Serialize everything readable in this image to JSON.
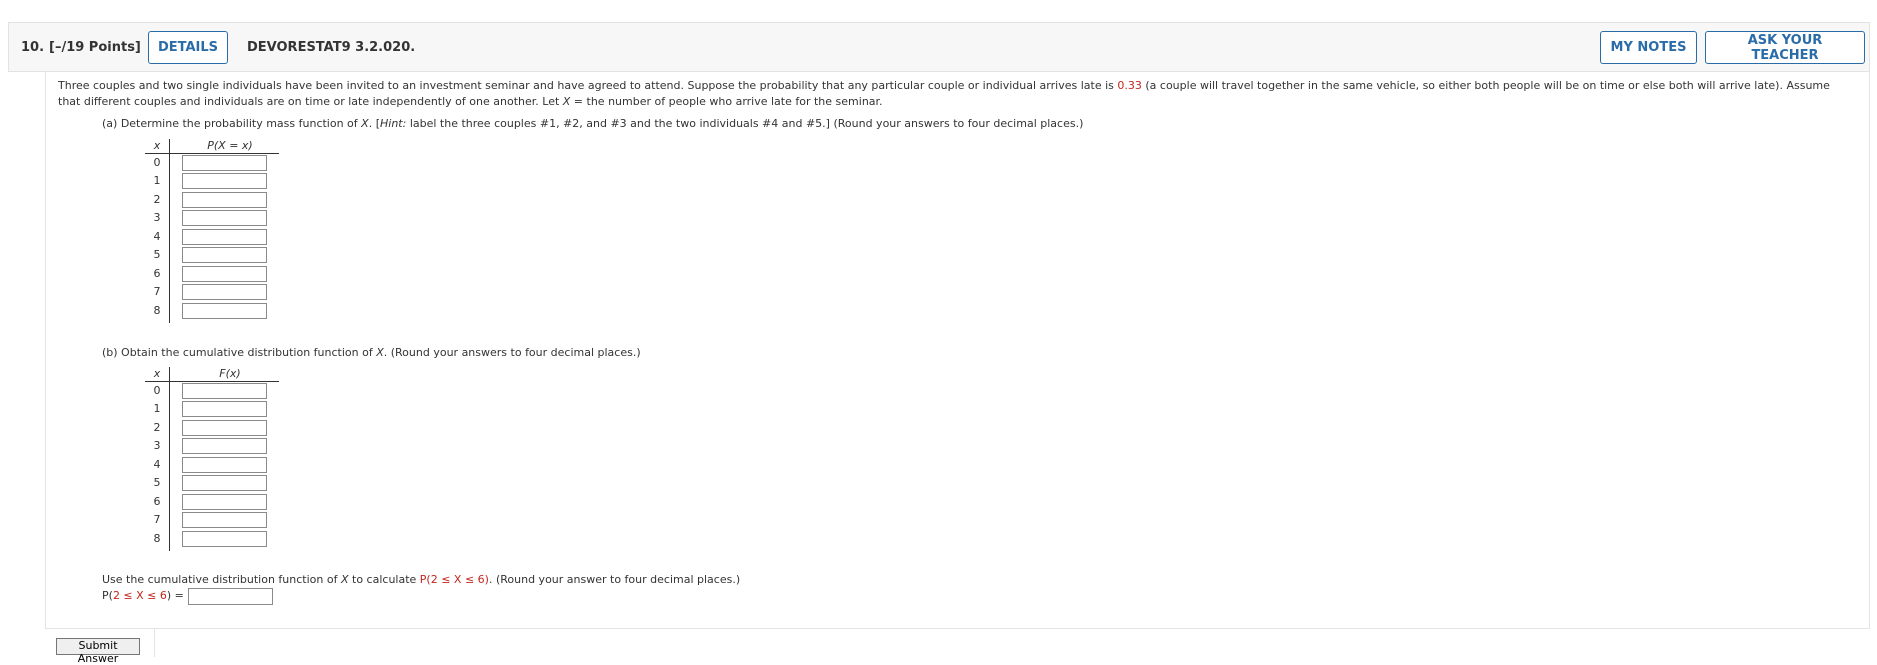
{
  "header": {
    "number": "10.",
    "points": "[–/19 Points]",
    "details_label": "DETAILS",
    "code": "DEVORESTAT9 3.2.020.",
    "my_notes_label": "MY NOTES",
    "ask_teacher_label": "ASK YOUR TEACHER"
  },
  "prompt": {
    "p1": "Three couples and two single individuals have been invited to an investment seminar and have agreed to attend. Suppose the probability that any particular couple or individual arrives late is ",
    "prob": "0.33",
    "p2": " (a couple will travel together in the same vehicle, so either both people will be on time or else both will arrive late). Assume that different couples and individuals are on time or late independently of one another. Let ",
    "var": "X",
    "p3": " = the number of people who arrive late for the seminar."
  },
  "part_a": {
    "label_1": "(a) Determine the probability mass function of ",
    "var": "X",
    "label_2": ". [",
    "hint": "Hint:",
    "label_3": " label the three couples #1, #2, and #3 and the two individuals #4 and #5.] (Round your answers to four decimal places.)",
    "col_x": "x",
    "col_p": "P(X = x)",
    "rows": [
      "0",
      "1",
      "2",
      "3",
      "4",
      "5",
      "6",
      "7",
      "8"
    ]
  },
  "part_b": {
    "label_1": "(b) Obtain the cumulative distribution function of ",
    "var": "X",
    "label_2": ". (Round your answers to four decimal places.)",
    "col_x": "x",
    "col_f": "F(x)",
    "rows": [
      "0",
      "1",
      "2",
      "3",
      "4",
      "5",
      "6",
      "7",
      "8"
    ]
  },
  "part_c": {
    "text_1": "Use the cumulative distribution function of ",
    "var": "X",
    "text_2": " to calculate ",
    "expr": "P(2 ≤ X ≤ 6)",
    "text_3": ". (Round your answer to four decimal places.)",
    "lhs_1": "P(",
    "lhs_red": "2 ≤ X ≤ 6",
    "lhs_2": ") ="
  },
  "submit_label": "Submit Answer",
  "colors": {
    "accent": "#2a6ca8",
    "highlight": "#c4261d"
  }
}
